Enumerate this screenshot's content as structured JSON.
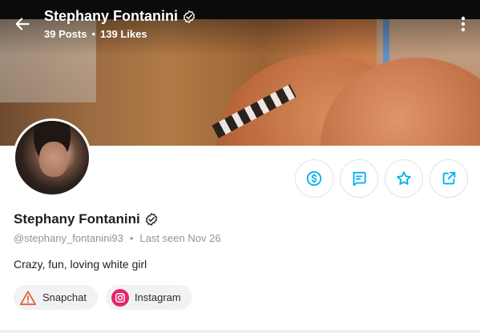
{
  "header": {
    "name": "Stephany Fontanini",
    "posts": "39 Posts",
    "separator": "•",
    "likes": "139 Likes"
  },
  "profile": {
    "name": "Stephany Fontanini",
    "handle": "@stephany_fontanini93",
    "separator": "•",
    "last_seen": "Last seen Nov 26",
    "bio": "Crazy, fun, loving white girl"
  },
  "social_links": [
    {
      "label": "Snapchat",
      "icon": "warning-icon"
    },
    {
      "label": "Instagram",
      "icon": "instagram-icon"
    }
  ],
  "actions": [
    {
      "name": "tip",
      "icon": "dollar-icon"
    },
    {
      "name": "message",
      "icon": "message-icon"
    },
    {
      "name": "favorite",
      "icon": "star-icon"
    },
    {
      "name": "share",
      "icon": "share-icon"
    }
  ],
  "colors": {
    "accent": "#00aff0",
    "muted_text": "#8a96a3",
    "instagram": "#e6236b",
    "warning": "#e0633a"
  }
}
